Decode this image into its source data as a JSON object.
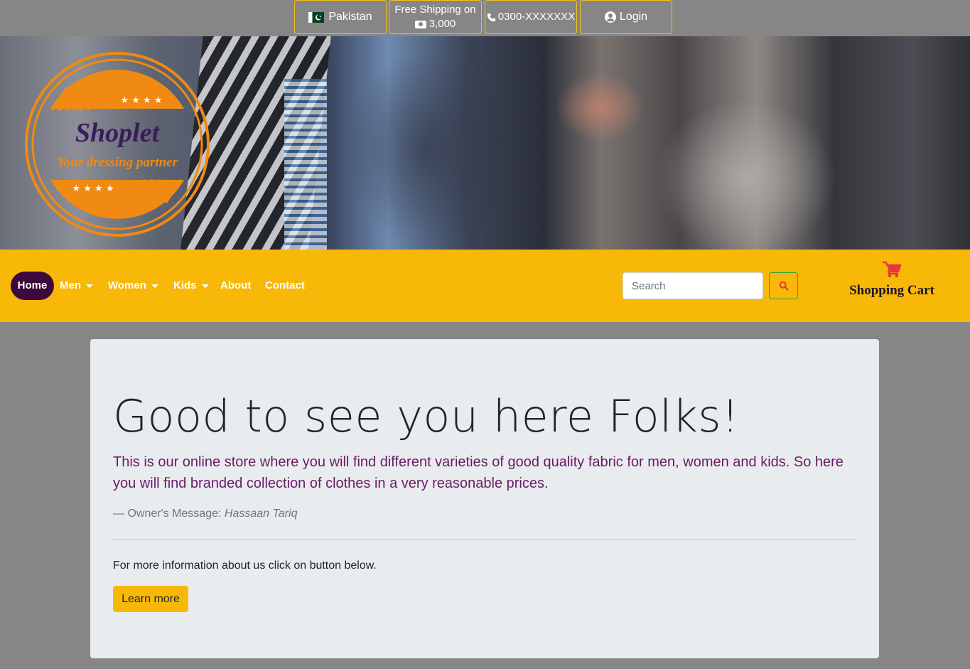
{
  "topbar": {
    "country": "Pakistan",
    "shipping_line1": "Free Shipping on",
    "shipping_amount": "3,000",
    "phone": "0300-XXXXXXX",
    "login": "Login"
  },
  "logo": {
    "name": "Shoplet",
    "tagline": "Your dressing partner",
    "stars": "★ ★ ★ ★"
  },
  "nav": {
    "items": [
      {
        "label": "Home",
        "active": true,
        "dropdown": false
      },
      {
        "label": "Men",
        "active": false,
        "dropdown": true
      },
      {
        "label": "Women",
        "active": false,
        "dropdown": true
      },
      {
        "label": "Kids",
        "active": false,
        "dropdown": true
      },
      {
        "label": "About",
        "active": false,
        "dropdown": false
      },
      {
        "label": "Contact",
        "active": false,
        "dropdown": false
      }
    ],
    "search_placeholder": "Search",
    "cart_label": "Shopping Cart"
  },
  "jumbotron": {
    "heading": "Good to see you here Folks!",
    "lead": "This is our online store where you will find different varieties of good quality fabric for men, women and kids. So here you will find branded collection of clothes in a very reasonable prices.",
    "owner_prefix": "— Owner's Message: ",
    "owner_name": "Hassaan Tariq",
    "info": "For more information about us click on button below.",
    "button": "Learn more"
  },
  "colors": {
    "accent": "#f8b808",
    "nav_active": "#3c0a3c",
    "lead_text": "#6b1a66",
    "cart_icon": "#e8363c",
    "logo_orange": "#f08a12",
    "logo_purple": "#3a1c5c"
  }
}
